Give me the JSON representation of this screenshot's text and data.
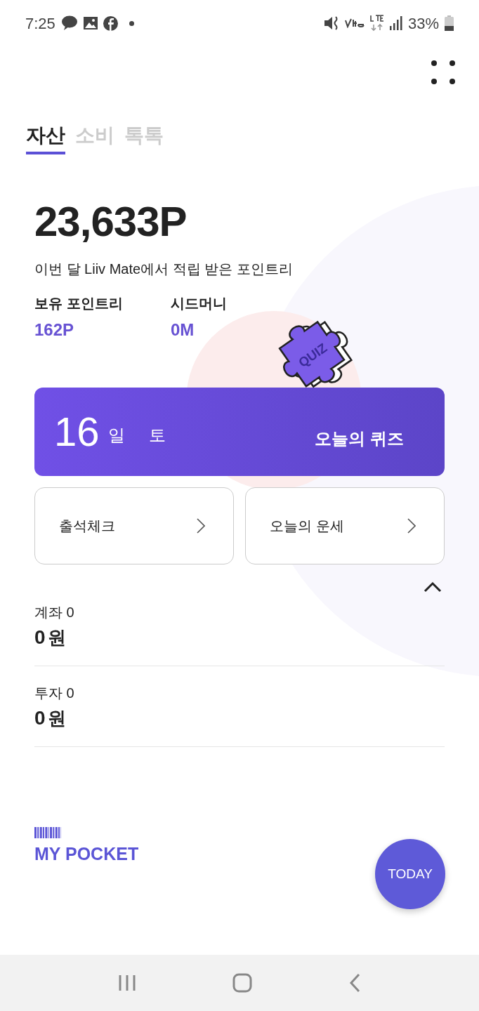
{
  "status_bar": {
    "time": "7:25",
    "battery": "33%"
  },
  "tabs": [
    {
      "label": "자산",
      "selected": true
    },
    {
      "label": "소비",
      "selected": false
    },
    {
      "label": "톡톡",
      "selected": false
    }
  ],
  "summary": {
    "points": "23,633P",
    "caption": "이번 달 Liiv Mate에서 적립 받은 포인트리"
  },
  "stats": [
    {
      "label": "보유 포인트리",
      "value": "162P"
    },
    {
      "label": "시드머니",
      "value": "0M"
    }
  ],
  "quiz_banner": {
    "day": "16",
    "day_unit": "일",
    "weekday": "토",
    "title": "오늘의 퀴즈",
    "badge": "QUIZ"
  },
  "shortcuts": [
    {
      "label": "출석체크"
    },
    {
      "label": "오늘의 운세"
    }
  ],
  "accounts": {
    "expanded": true,
    "items": [
      {
        "label": "계좌 0",
        "amount": "0",
        "unit": "원"
      },
      {
        "label": "투자 0",
        "amount": "0",
        "unit": "원"
      }
    ]
  },
  "pocket": {
    "label": "MY POCKET"
  },
  "fab": {
    "label": "TODAY"
  }
}
